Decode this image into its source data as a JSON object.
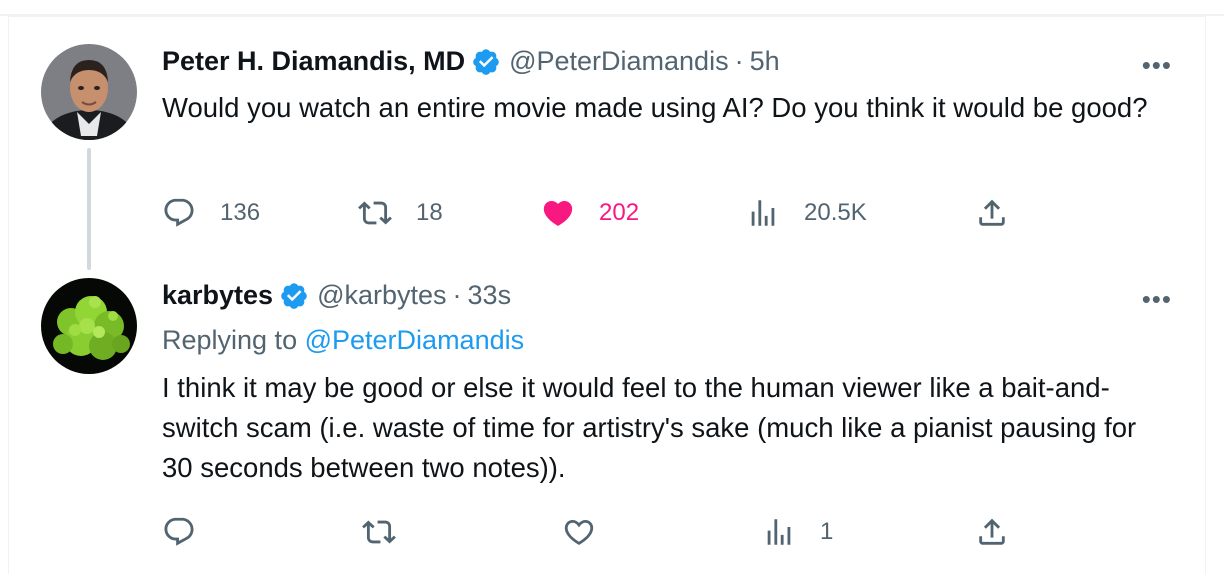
{
  "tweets": [
    {
      "name": "Peter H. Diamandis, MD",
      "handle": "@PeterDiamandis",
      "dot": "·",
      "time": "5h",
      "text": "Would you watch an entire movie made using AI? Do you think it would be good?",
      "replies": "136",
      "retweets": "18",
      "likes": "202",
      "views": "20.5K",
      "liked": true
    },
    {
      "name": "karbytes",
      "handle": "@karbytes",
      "dot": "·",
      "time": "33s",
      "replying_prefix": "Replying to",
      "replying_handle": "@PeterDiamandis",
      "text": "I think it may be good or else it would feel to the human viewer like a bait-and-switch scam (i.e. waste of time for artistry's sake (much like a pianist pausing for 30 seconds between two notes)).",
      "views": "1"
    }
  ],
  "icons": {
    "verified": "verified-badge-icon",
    "more": "more-icon",
    "reply": "reply-icon",
    "retweet": "retweet-icon",
    "like": "heart-icon",
    "views": "views-icon",
    "share": "share-icon"
  },
  "more_glyph": "•••",
  "colors": {
    "verified": "#1d9bf0",
    "like": "#f91880",
    "muted": "#536471",
    "text": "#0f1419"
  }
}
